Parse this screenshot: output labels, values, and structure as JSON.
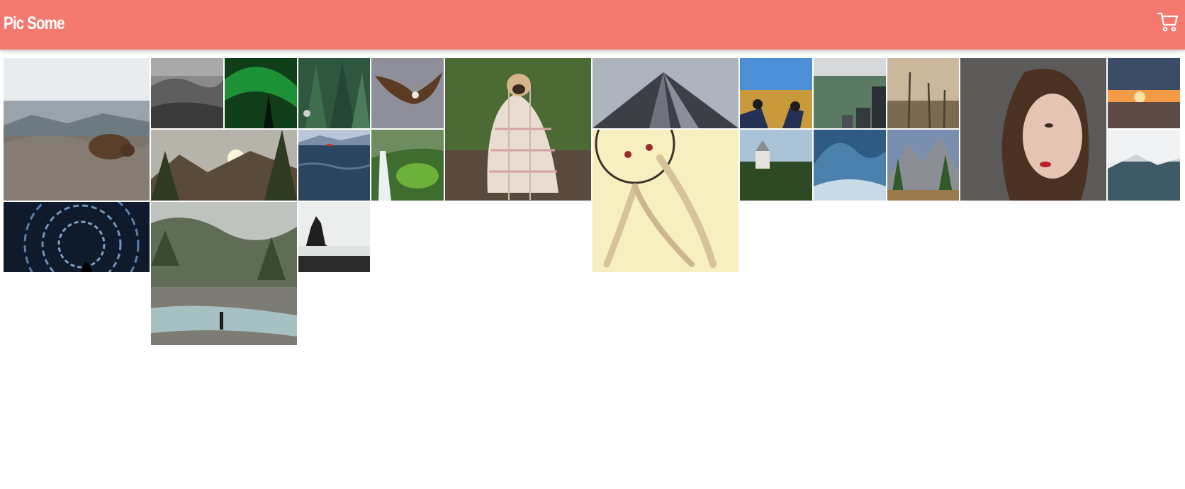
{
  "header": {
    "brand": "Pic Some",
    "cart_icon": "cart-icon",
    "background": "#f47a6f"
  },
  "gallery": {
    "photos": [
      "bear-on-rocks",
      "foggy-forest-mountains",
      "aurora-tree",
      "pine-forest-closeup",
      "eagle-flying",
      "pug-in-blanket",
      "skyscraper-low-angle",
      "sneakers-on-grass",
      "city-park-aerial",
      "dead-trees-fog",
      "woman-portrait",
      "sunset-railway",
      "mountain-sunset-pines",
      "ocean-waves-boat",
      "waterfall-green-cliff",
      "dreamcatcher-sunlight",
      "castle-on-hill",
      "blue-wave",
      "yosemite-valley",
      "misty-mountain-ridge",
      "star-trails-swirl",
      "river-hiker-forest",
      "sea-stack-beach"
    ]
  }
}
